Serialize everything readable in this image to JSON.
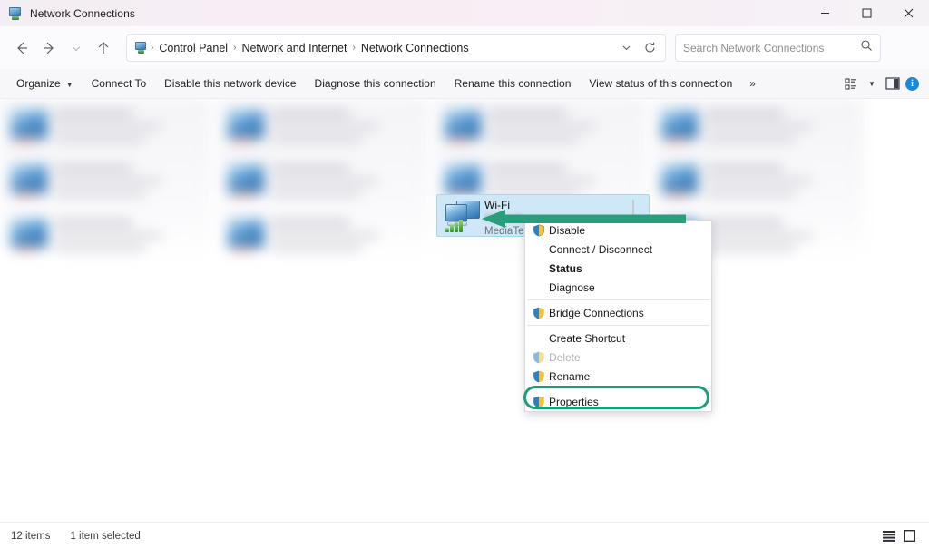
{
  "window": {
    "title": "Network Connections",
    "icon": "network-connections-icon",
    "controls": {
      "minimize": "minimize-button",
      "maximize": "maximize-button",
      "close": "close-button"
    }
  },
  "address_bar": {
    "back": "back-button",
    "forward": "forward-button",
    "recent": "recent-locations-button",
    "up": "up-button",
    "breadcrumbs": [
      "Control Panel",
      "Network and Internet",
      "Network Connections"
    ],
    "separator": "›",
    "dropdown": "address-dropdown",
    "refresh": "refresh-button"
  },
  "search": {
    "placeholder": "Search Network Connections",
    "value": "",
    "icon": "search-icon"
  },
  "command_bar": {
    "items": [
      {
        "label": "Organize",
        "has_caret": true
      },
      {
        "label": "Connect To",
        "has_caret": false
      },
      {
        "label": "Disable this network device",
        "has_caret": false
      },
      {
        "label": "Diagnose this connection",
        "has_caret": false
      },
      {
        "label": "Rename this connection",
        "has_caret": false
      },
      {
        "label": "View status of this connection",
        "has_caret": false
      }
    ],
    "overflow": "»",
    "view_options_icon": "view-options-icon",
    "view_caret": "▾",
    "preview_pane_icon": "preview-pane-icon",
    "help_icon": "help-icon",
    "help_glyph": "i"
  },
  "selected_item": {
    "name": "Wi-Fi",
    "network": "",
    "adapter": "MediaTek",
    "icon": "wifi-adapter-icon",
    "selected": true
  },
  "context_menu": {
    "items": [
      {
        "label": "Disable",
        "shield": true,
        "bold": false,
        "disabled": false,
        "separator_after": false
      },
      {
        "label": "Connect / Disconnect",
        "shield": false,
        "bold": false,
        "disabled": false,
        "separator_after": false
      },
      {
        "label": "Status",
        "shield": false,
        "bold": true,
        "disabled": false,
        "separator_after": false
      },
      {
        "label": "Diagnose",
        "shield": false,
        "bold": false,
        "disabled": false,
        "separator_after": true
      },
      {
        "label": "Bridge Connections",
        "shield": true,
        "bold": false,
        "disabled": false,
        "separator_after": true
      },
      {
        "label": "Create Shortcut",
        "shield": false,
        "bold": false,
        "disabled": false,
        "separator_after": false
      },
      {
        "label": "Delete",
        "shield": true,
        "bold": false,
        "disabled": true,
        "separator_after": false
      },
      {
        "label": "Rename",
        "shield": true,
        "bold": false,
        "disabled": false,
        "separator_after": true
      },
      {
        "label": "Properties",
        "shield": true,
        "bold": false,
        "disabled": false,
        "separator_after": false
      }
    ]
  },
  "annotations": {
    "arrow": {
      "name": "pointer-arrow",
      "color": "#1f9d78",
      "points_to": "Wi-Fi"
    },
    "highlight": {
      "name": "properties-highlight",
      "color": "#1f9d78",
      "target": "Properties"
    }
  },
  "status_bar": {
    "item_count": "12 items",
    "selection": "1 item selected",
    "details_view_icon": "details-view-icon",
    "large_icons_view_icon": "large-icons-view-icon"
  },
  "colors": {
    "accent_green": "#1f9d78",
    "selection_blue": "#cfe8f7",
    "titlebar": "#f5eef4",
    "help_blue": "#1a8ad6"
  }
}
